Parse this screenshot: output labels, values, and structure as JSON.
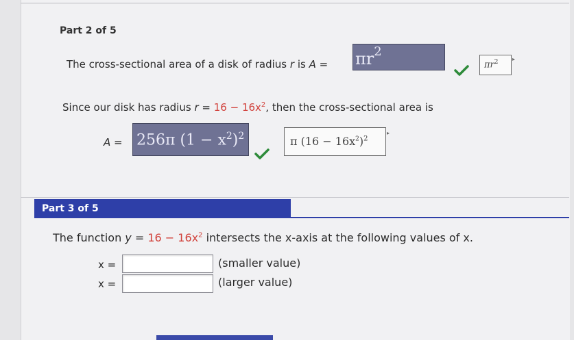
{
  "part2": {
    "header": "Part 2 of 5",
    "q1": {
      "prefix": "The cross-sectional area of a disk of radius",
      "var_r": "r",
      "is": "is",
      "var_a": "A",
      "equals": "=",
      "student_answer": "πr",
      "student_exp": "2",
      "correct_answer": "πr",
      "correct_exp": "2"
    },
    "q2": {
      "prefix": "Since our disk has radius",
      "var_r": "r",
      "equals": "=",
      "radius_expr": "16 − 16x",
      "radius_exp": "2",
      "suffix": ", then the cross-sectional area is",
      "var_a": "A",
      "equals2": "=",
      "student_answer": "256π (1 − x",
      "student_inner_exp": "2",
      "student_close": ")",
      "student_outer_exp": "2",
      "correct_answer": "π (16 − 16x",
      "correct_inner_exp": "2",
      "correct_close": ")",
      "correct_outer_exp": "2"
    }
  },
  "part3": {
    "header": "Part 3 of 5",
    "question": {
      "prefix": "The function",
      "var_y": "y",
      "equals": "=",
      "func_expr": "16 − 16x",
      "func_exp": "2",
      "suffix": "intersects the x-axis at the following values of x."
    },
    "inputs": [
      {
        "label": "x =",
        "value": "",
        "hint": "(smaller value)"
      },
      {
        "label": "x =",
        "value": "",
        "hint": "(larger value)"
      }
    ]
  },
  "colors": {
    "accent_blue": "#2e3fa8",
    "answer_box": "#6f7294",
    "check_green": "#2e8b3a",
    "expr_red": "#d1403a"
  },
  "icons": {
    "check": "check-icon",
    "expand": "expand-arrow-icon"
  }
}
